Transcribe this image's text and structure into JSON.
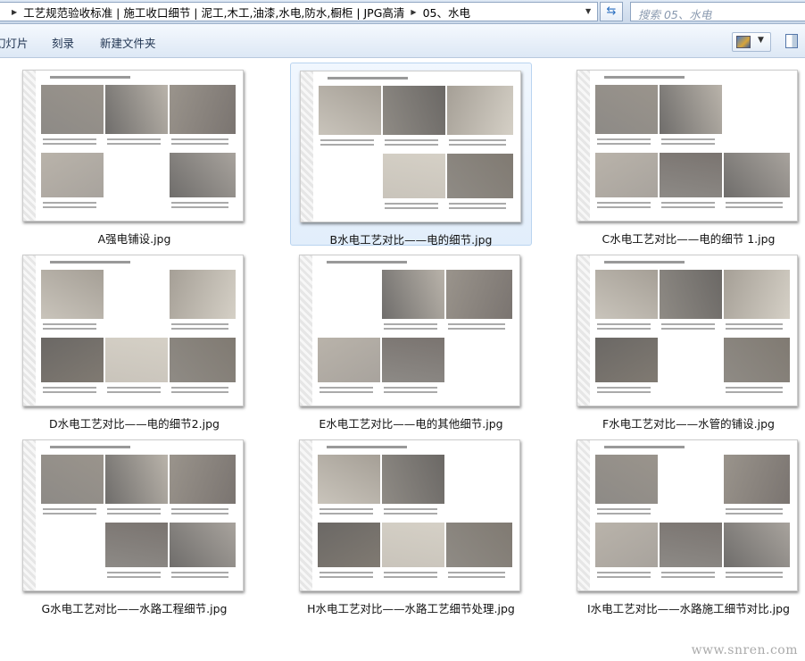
{
  "address_bar": {
    "crumbs": [
      "工艺规范验收标准 | 施工收口细节 | 泥工,木工,油漆,水电,防水,橱柜 | JPG高清",
      "05、水电"
    ],
    "search_placeholder": "搜索 05、水电"
  },
  "toolbar": {
    "slideshow": "幻灯片",
    "burn": "刻录",
    "new_folder": "新建文件夹"
  },
  "files": [
    {
      "name": "A强电铺设.jpg"
    },
    {
      "name": "B水电工艺对比——电的细节.jpg",
      "selected": true
    },
    {
      "name": "C水电工艺对比——电的细节 1.jpg"
    },
    {
      "name": "D水电工艺对比——电的细节2.jpg"
    },
    {
      "name": "E水电工艺对比——电的其他细节.jpg"
    },
    {
      "name": "F水电工艺对比——水管的铺设.jpg"
    },
    {
      "name": "G水电工艺对比——水路工程细节.jpg"
    },
    {
      "name": "H水电工艺对比——水路工艺细节处理.jpg"
    },
    {
      "name": "I水电工艺对比——水路施工细节对比.jpg"
    }
  ],
  "watermark": "www.snren.com"
}
